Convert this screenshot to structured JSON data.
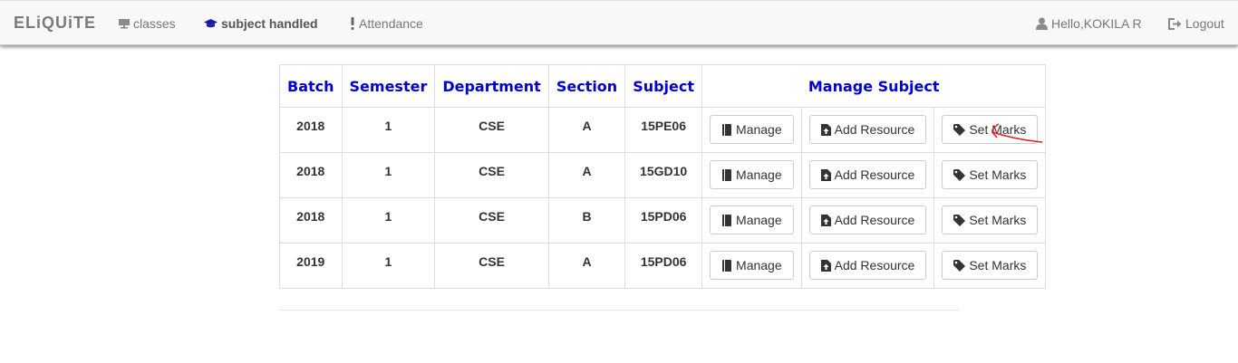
{
  "navbar": {
    "brand": "ELiQUiTE",
    "items": [
      {
        "label": "classes",
        "icon": "monitor-icon"
      },
      {
        "label": "subject handled",
        "icon": "graduation-cap-icon",
        "active": true
      },
      {
        "label": "Attendance",
        "icon": "exclamation-icon"
      }
    ],
    "user": "Hello,KOKILA R",
    "logout": "Logout"
  },
  "table": {
    "headers": [
      "Batch",
      "Semester",
      "Department",
      "Section",
      "Subject",
      "Manage Subject"
    ],
    "actions": {
      "manage": "Manage",
      "add_resource": "Add Resource",
      "set_marks": "Set Marks"
    },
    "rows": [
      {
        "batch": "2018",
        "semester": "1",
        "department": "CSE",
        "section": "A",
        "subject": "15PE06"
      },
      {
        "batch": "2018",
        "semester": "1",
        "department": "CSE",
        "section": "A",
        "subject": "15GD10"
      },
      {
        "batch": "2018",
        "semester": "1",
        "department": "CSE",
        "section": "B",
        "subject": "15PD06"
      },
      {
        "batch": "2019",
        "semester": "1",
        "department": "CSE",
        "section": "A",
        "subject": "15PD06"
      }
    ]
  },
  "colors": {
    "header_text": "#0000cc",
    "annotation": "#e02020"
  }
}
